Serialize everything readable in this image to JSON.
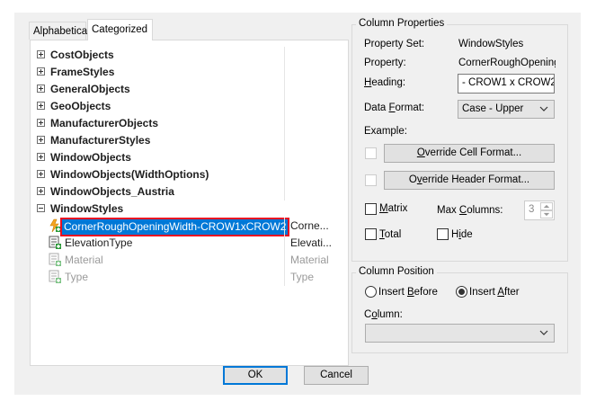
{
  "tabs": [
    "Alphabetical",
    "Categorized"
  ],
  "tree": {
    "categories": [
      {
        "label": "CostObjects",
        "expanded": false
      },
      {
        "label": "FrameStyles",
        "expanded": false
      },
      {
        "label": "GeneralObjects",
        "expanded": false
      },
      {
        "label": "GeoObjects",
        "expanded": false
      },
      {
        "label": "ManufacturerObjects",
        "expanded": false
      },
      {
        "label": "ManufacturerStyles",
        "expanded": false
      },
      {
        "label": "WindowObjects",
        "expanded": false
      },
      {
        "label": "WindowObjects(WidthOptions)",
        "expanded": false
      },
      {
        "label": "WindowObjects_Austria",
        "expanded": false
      },
      {
        "label": "WindowStyles",
        "expanded": true
      }
    ],
    "properties": [
      {
        "label": "CornerRoughOpeningWidth-CROW1xCROW2",
        "value": "Corne...",
        "selected": true,
        "enabled": true
      },
      {
        "label": "ElevationType",
        "value": "Elevati...",
        "selected": false,
        "enabled": true
      },
      {
        "label": "Material",
        "value": "Material",
        "selected": false,
        "enabled": false
      },
      {
        "label": "Type",
        "value": "Type",
        "selected": false,
        "enabled": false
      }
    ]
  },
  "column_properties": {
    "title": "Column Properties",
    "property_set_label": "Property Set:",
    "property_set_value": "WindowStyles",
    "property_label": "Property:",
    "property_value": "CornerRoughOpening\\",
    "heading_label": "Heading:",
    "heading_value": "- CROW1 x CROW2",
    "data_format_label": "Data Format:",
    "data_format_value": "Case - Upper",
    "example_label": "Example:",
    "override_cell_button": "Override Cell Format...",
    "override_header_button": "Override Header Format...",
    "matrix_label": "Matrix",
    "max_columns_label": "Max Columns:",
    "max_columns_value": "3",
    "total_label": "Total",
    "hide_label": "Hide"
  },
  "column_position": {
    "title": "Column Position",
    "insert_before_label": "Insert Before",
    "insert_after_label": "Insert After",
    "selected": "Insert After",
    "column_label": "Column:",
    "column_value": ""
  },
  "footer": {
    "ok_label": "OK",
    "cancel_label": "Cancel"
  }
}
